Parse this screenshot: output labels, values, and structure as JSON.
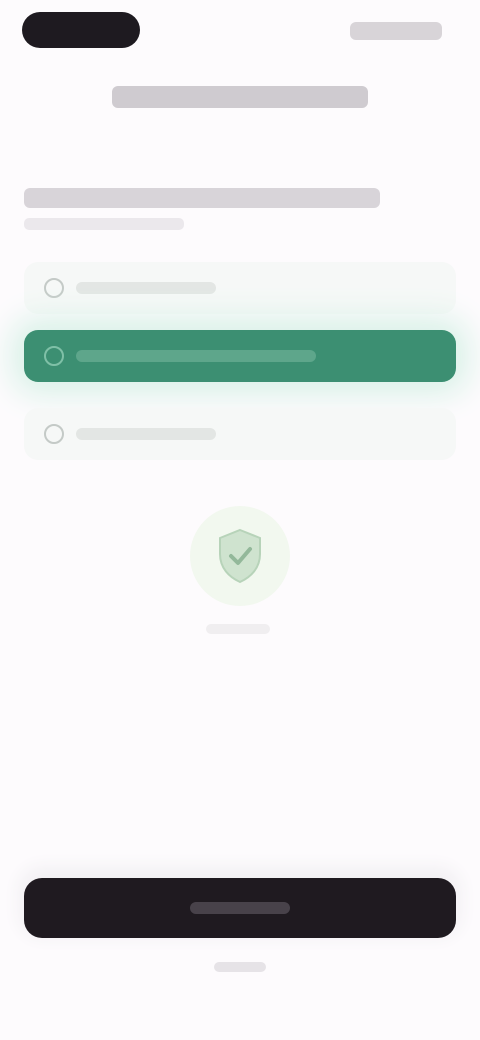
{
  "status_bar": {},
  "header": {},
  "options": [
    {
      "label": ""
    },
    {
      "label": "",
      "selected": true
    },
    {
      "label": ""
    }
  ],
  "illustration": {
    "icon": "shield-check-icon"
  },
  "primary_button": {
    "label": ""
  },
  "footer": {},
  "colors": {
    "accent": "#3c8f72",
    "accent_glow": "#d8f1e7",
    "button_dark": "#1f1a20",
    "background": "#fdfbfd"
  }
}
